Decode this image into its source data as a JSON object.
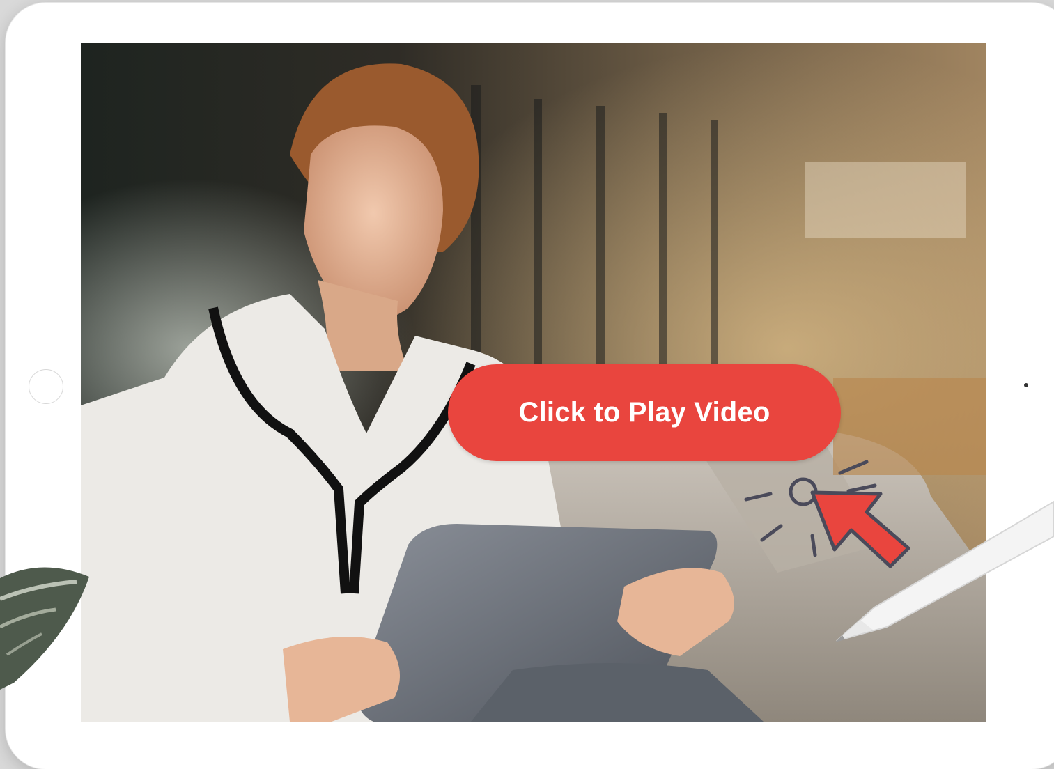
{
  "video": {
    "play_label": "Click to Play Video"
  },
  "icons": {
    "cursor": "hand-cursor-click-icon",
    "leaf": "leaf-decoration",
    "pencil": "stylus-pencil"
  },
  "colors": {
    "play_button": "#e9453e",
    "play_text": "#ffffff",
    "tablet_bezel": "#ffffff",
    "cursor_outline": "#4a4a5a"
  }
}
